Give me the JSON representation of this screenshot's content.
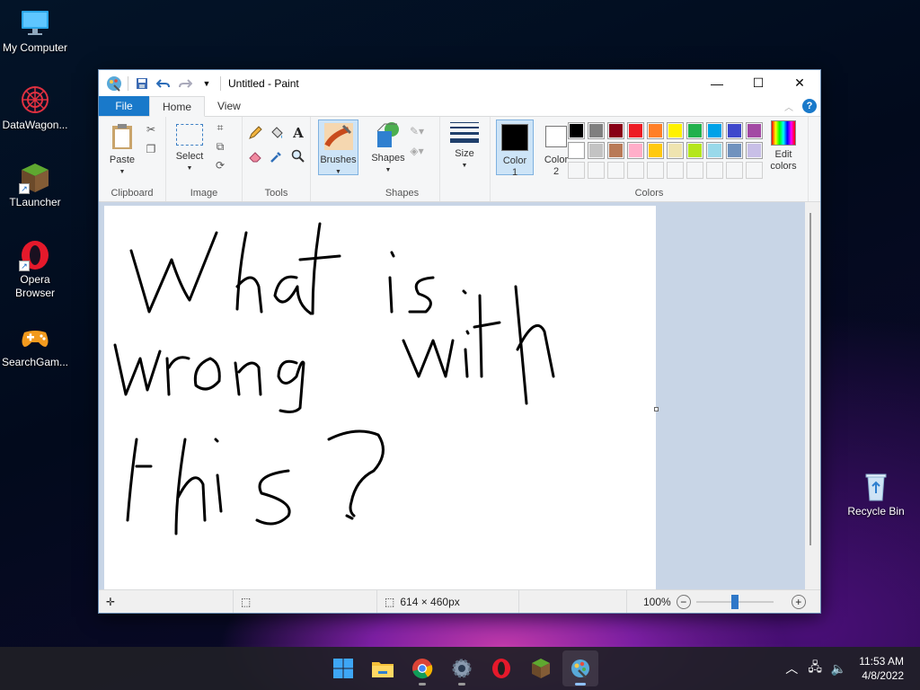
{
  "desktop": {
    "icons": [
      {
        "label": "My Computer"
      },
      {
        "label": "DataWagon..."
      },
      {
        "label": "TLauncher"
      },
      {
        "label": "Opera\nBrowser"
      },
      {
        "label": "SearchGam..."
      },
      {
        "label": "Recycle Bin"
      }
    ]
  },
  "window": {
    "title": "Untitled - Paint",
    "tabs": {
      "file": "File",
      "home": "Home",
      "view": "View"
    },
    "ribbon": {
      "clipboard": {
        "paste": "Paste",
        "label": "Clipboard"
      },
      "image": {
        "select": "Select",
        "label": "Image"
      },
      "tools": {
        "label": "Tools"
      },
      "brushes": {
        "label": "Brushes"
      },
      "shapes": {
        "shapes": "Shapes",
        "label": "Shapes"
      },
      "size": {
        "label": "Size"
      },
      "color1": {
        "label": "Color\n1",
        "value": "#000000"
      },
      "color2": {
        "label": "Color\n2",
        "value": "#ffffff"
      },
      "colors_label": "Colors",
      "edit_colors": "Edit\ncolors",
      "palette": [
        "#000000",
        "#7f7f7f",
        "#880015",
        "#ed1c24",
        "#ff7f27",
        "#fff200",
        "#22b14c",
        "#00a2e8",
        "#3f48cc",
        "#a349a4",
        "#ffffff",
        "#c3c3c3",
        "#b97a57",
        "#ffaec9",
        "#ffc90e",
        "#efe4b0",
        "#b5e61d",
        "#99d9ea",
        "#7092be",
        "#c8bfe7"
      ]
    },
    "canvas_text": [
      "What is .",
      "wrong with",
      "this?"
    ],
    "status": {
      "dimensions": "614 × 460px",
      "zoom": "100%",
      "zoom_level": 1.0
    }
  },
  "taskbar": {
    "apps": [
      "start",
      "file-explorer",
      "chrome",
      "settings",
      "opera",
      "tlauncher",
      "paint"
    ],
    "time": "11:53 AM",
    "date": "4/8/2022"
  }
}
